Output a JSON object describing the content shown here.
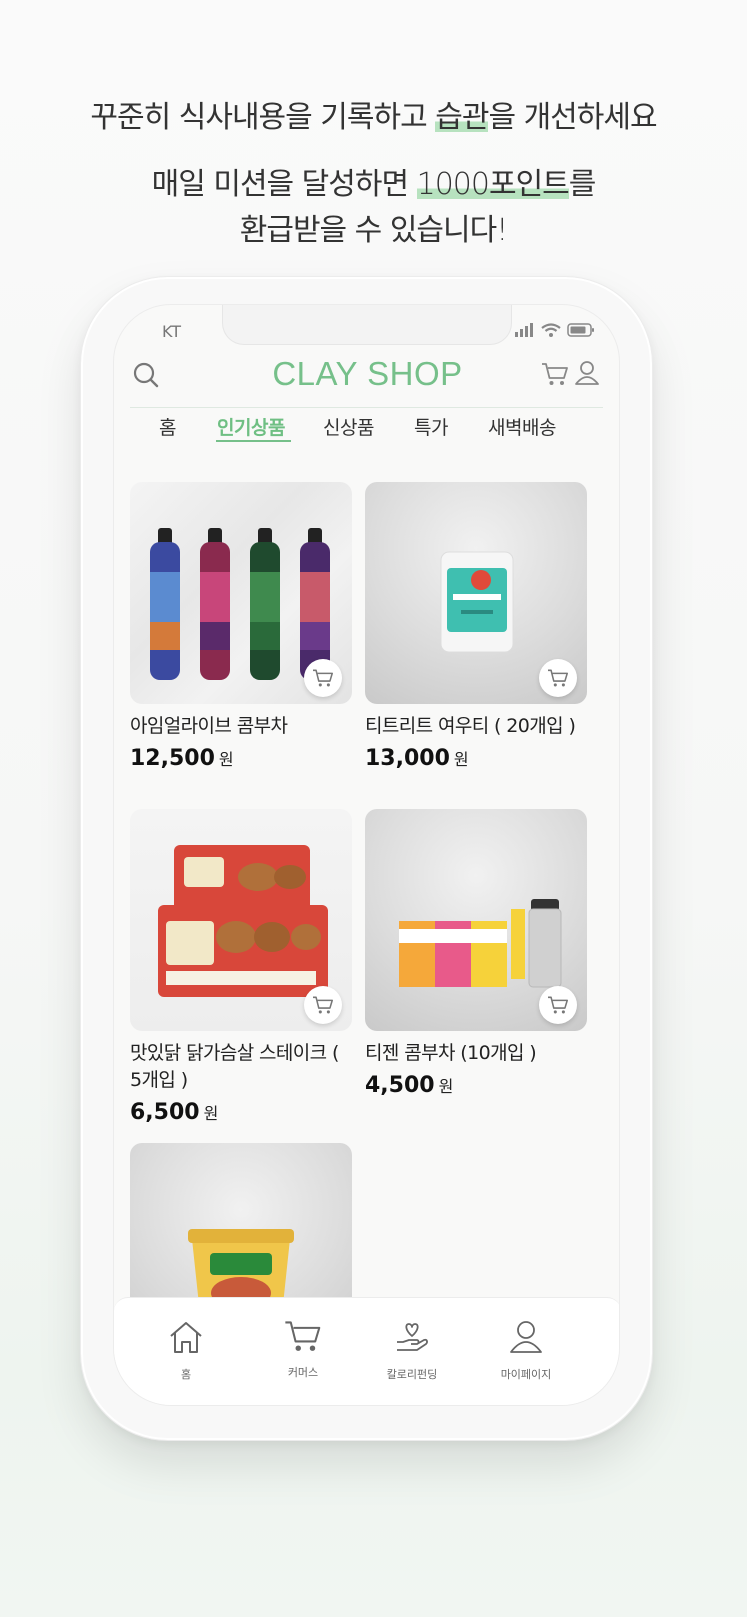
{
  "promo": {
    "line1_pre": "꾸준히 식사내용을 기록하고 ",
    "line1_hl": "습관",
    "line1_post": "을 개선하세요",
    "line2_pre": "매일 미션을 달성하면 ",
    "line2_hl": "1000포인트",
    "line2_post": "를",
    "line3": "환급받을 수 있습니다!"
  },
  "status_bar": {
    "carrier": "KT"
  },
  "app": {
    "title": "CLAY SHOP"
  },
  "tabs": [
    {
      "label": "홈"
    },
    {
      "label": "인기상품",
      "active": true
    },
    {
      "label": "신상품"
    },
    {
      "label": "특가"
    },
    {
      "label": "새벽배송"
    }
  ],
  "products": [
    {
      "name": "아임얼라이브 콤부차",
      "price": "12,500",
      "unit": "원"
    },
    {
      "name": "티트리트 여우티 ( 20개입 )",
      "price": "13,000",
      "unit": "원"
    },
    {
      "name": "맛있닭 닭가슴살 스테이크 ( 5개입 )",
      "price": "6,500",
      "unit": "원"
    },
    {
      "name": "티젠 콤부차 (10개입 )",
      "price": "4,500",
      "unit": "원"
    },
    {
      "name": "",
      "price": "",
      "unit": ""
    }
  ],
  "bottom_nav": [
    {
      "label": "홈",
      "icon": "home-icon"
    },
    {
      "label": "커머스",
      "icon": "cart-icon"
    },
    {
      "label": "칼로리펀딩",
      "icon": "heart-hand-icon"
    },
    {
      "label": "마이페이지",
      "icon": "person-icon"
    }
  ],
  "colors": {
    "accent": "#76c08a",
    "highlight": "#b7e2bf"
  }
}
